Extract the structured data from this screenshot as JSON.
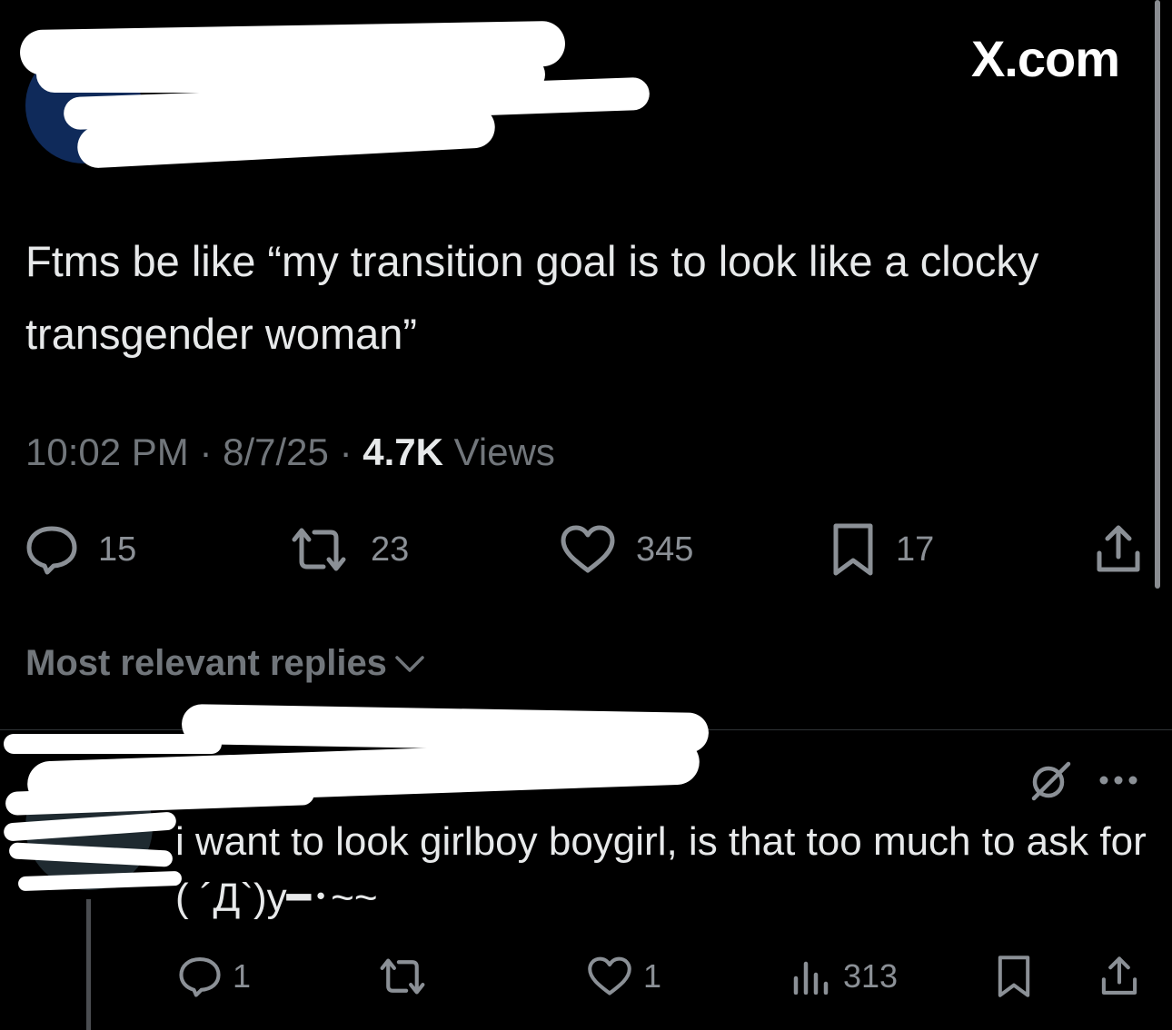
{
  "header": {
    "brand": "X.com"
  },
  "tweet": {
    "text": "Ftms be like “my transition goal is to look like a clocky transgender woman”",
    "time": "10:02 PM",
    "date": "8/7/25",
    "views_count": "4.7K",
    "views_label": "Views",
    "separator": "·",
    "replies": "15",
    "reposts": "23",
    "likes": "345",
    "bookmarks": "17"
  },
  "replies_section": {
    "sort_label": "Most relevant replies"
  },
  "reply": {
    "text": "i want to look girlboy boygirl, is that too much to ask for ( ´Д`)y━･~~",
    "replies": "1",
    "likes": "1",
    "views": "313"
  },
  "colors": {
    "background": "#000000",
    "text": "#e7e9ea",
    "muted": "#71767b",
    "redaction": "#ffffff"
  },
  "icons": [
    "reply-icon",
    "repost-icon",
    "like-icon",
    "bookmark-icon",
    "share-icon",
    "chevron-down-icon",
    "grok-icon",
    "more-icon",
    "views-icon"
  ]
}
